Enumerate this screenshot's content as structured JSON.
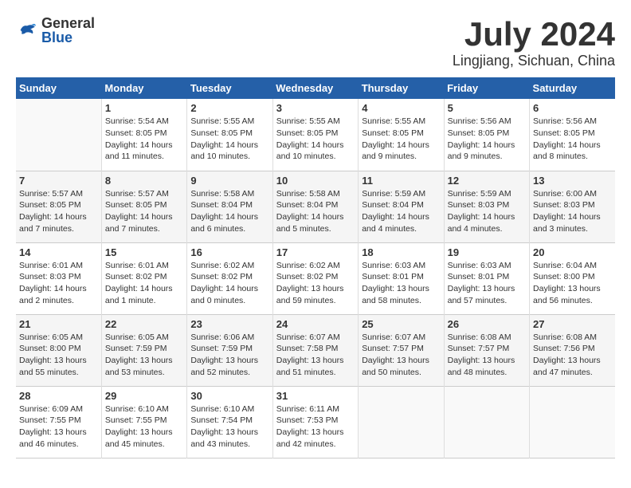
{
  "header": {
    "logo_general": "General",
    "logo_blue": "Blue",
    "month": "July 2024",
    "location": "Lingjiang, Sichuan, China"
  },
  "weekdays": [
    "Sunday",
    "Monday",
    "Tuesday",
    "Wednesday",
    "Thursday",
    "Friday",
    "Saturday"
  ],
  "weeks": [
    [
      {
        "day": "",
        "info": ""
      },
      {
        "day": "1",
        "info": "Sunrise: 5:54 AM\nSunset: 8:05 PM\nDaylight: 14 hours\nand 11 minutes."
      },
      {
        "day": "2",
        "info": "Sunrise: 5:55 AM\nSunset: 8:05 PM\nDaylight: 14 hours\nand 10 minutes."
      },
      {
        "day": "3",
        "info": "Sunrise: 5:55 AM\nSunset: 8:05 PM\nDaylight: 14 hours\nand 10 minutes."
      },
      {
        "day": "4",
        "info": "Sunrise: 5:55 AM\nSunset: 8:05 PM\nDaylight: 14 hours\nand 9 minutes."
      },
      {
        "day": "5",
        "info": "Sunrise: 5:56 AM\nSunset: 8:05 PM\nDaylight: 14 hours\nand 9 minutes."
      },
      {
        "day": "6",
        "info": "Sunrise: 5:56 AM\nSunset: 8:05 PM\nDaylight: 14 hours\nand 8 minutes."
      }
    ],
    [
      {
        "day": "7",
        "info": "Sunrise: 5:57 AM\nSunset: 8:05 PM\nDaylight: 14 hours\nand 7 minutes."
      },
      {
        "day": "8",
        "info": "Sunrise: 5:57 AM\nSunset: 8:05 PM\nDaylight: 14 hours\nand 7 minutes."
      },
      {
        "day": "9",
        "info": "Sunrise: 5:58 AM\nSunset: 8:04 PM\nDaylight: 14 hours\nand 6 minutes."
      },
      {
        "day": "10",
        "info": "Sunrise: 5:58 AM\nSunset: 8:04 PM\nDaylight: 14 hours\nand 5 minutes."
      },
      {
        "day": "11",
        "info": "Sunrise: 5:59 AM\nSunset: 8:04 PM\nDaylight: 14 hours\nand 4 minutes."
      },
      {
        "day": "12",
        "info": "Sunrise: 5:59 AM\nSunset: 8:03 PM\nDaylight: 14 hours\nand 4 minutes."
      },
      {
        "day": "13",
        "info": "Sunrise: 6:00 AM\nSunset: 8:03 PM\nDaylight: 14 hours\nand 3 minutes."
      }
    ],
    [
      {
        "day": "14",
        "info": "Sunrise: 6:01 AM\nSunset: 8:03 PM\nDaylight: 14 hours\nand 2 minutes."
      },
      {
        "day": "15",
        "info": "Sunrise: 6:01 AM\nSunset: 8:02 PM\nDaylight: 14 hours\nand 1 minute."
      },
      {
        "day": "16",
        "info": "Sunrise: 6:02 AM\nSunset: 8:02 PM\nDaylight: 14 hours\nand 0 minutes."
      },
      {
        "day": "17",
        "info": "Sunrise: 6:02 AM\nSunset: 8:02 PM\nDaylight: 13 hours\nand 59 minutes."
      },
      {
        "day": "18",
        "info": "Sunrise: 6:03 AM\nSunset: 8:01 PM\nDaylight: 13 hours\nand 58 minutes."
      },
      {
        "day": "19",
        "info": "Sunrise: 6:03 AM\nSunset: 8:01 PM\nDaylight: 13 hours\nand 57 minutes."
      },
      {
        "day": "20",
        "info": "Sunrise: 6:04 AM\nSunset: 8:00 PM\nDaylight: 13 hours\nand 56 minutes."
      }
    ],
    [
      {
        "day": "21",
        "info": "Sunrise: 6:05 AM\nSunset: 8:00 PM\nDaylight: 13 hours\nand 55 minutes."
      },
      {
        "day": "22",
        "info": "Sunrise: 6:05 AM\nSunset: 7:59 PM\nDaylight: 13 hours\nand 53 minutes."
      },
      {
        "day": "23",
        "info": "Sunrise: 6:06 AM\nSunset: 7:59 PM\nDaylight: 13 hours\nand 52 minutes."
      },
      {
        "day": "24",
        "info": "Sunrise: 6:07 AM\nSunset: 7:58 PM\nDaylight: 13 hours\nand 51 minutes."
      },
      {
        "day": "25",
        "info": "Sunrise: 6:07 AM\nSunset: 7:57 PM\nDaylight: 13 hours\nand 50 minutes."
      },
      {
        "day": "26",
        "info": "Sunrise: 6:08 AM\nSunset: 7:57 PM\nDaylight: 13 hours\nand 48 minutes."
      },
      {
        "day": "27",
        "info": "Sunrise: 6:08 AM\nSunset: 7:56 PM\nDaylight: 13 hours\nand 47 minutes."
      }
    ],
    [
      {
        "day": "28",
        "info": "Sunrise: 6:09 AM\nSunset: 7:55 PM\nDaylight: 13 hours\nand 46 minutes."
      },
      {
        "day": "29",
        "info": "Sunrise: 6:10 AM\nSunset: 7:55 PM\nDaylight: 13 hours\nand 45 minutes."
      },
      {
        "day": "30",
        "info": "Sunrise: 6:10 AM\nSunset: 7:54 PM\nDaylight: 13 hours\nand 43 minutes."
      },
      {
        "day": "31",
        "info": "Sunrise: 6:11 AM\nSunset: 7:53 PM\nDaylight: 13 hours\nand 42 minutes."
      },
      {
        "day": "",
        "info": ""
      },
      {
        "day": "",
        "info": ""
      },
      {
        "day": "",
        "info": ""
      }
    ]
  ]
}
